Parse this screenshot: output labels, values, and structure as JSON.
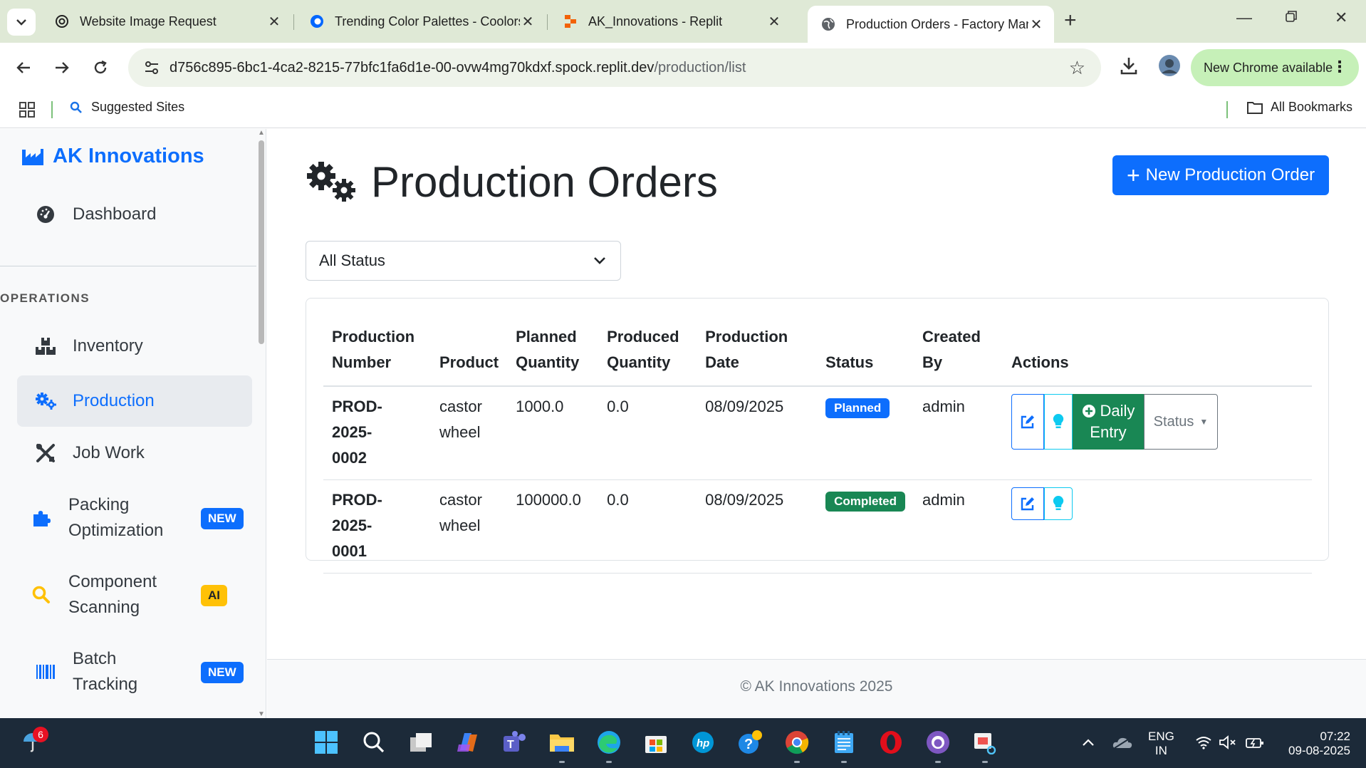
{
  "browser": {
    "tabs": [
      {
        "title": "Website Image Request",
        "icon": "openai-icon"
      },
      {
        "title": "Trending Color Palettes - Coolors",
        "icon": "coolors-icon"
      },
      {
        "title": "AK_Innovations - Replit",
        "icon": "replit-icon"
      },
      {
        "title": "Production Orders - Factory Management",
        "icon": "globe-icon"
      }
    ],
    "url_host": "d756c895-6bc1-4ca2-8215-77bfc1fa6d1e-00-ovw4mg70kdxf.spock.replit.dev",
    "url_path": "/production/list",
    "update_label": "New Chrome available",
    "bookmark_suggested": "Suggested Sites",
    "bookmark_all": "All Bookmarks"
  },
  "sidebar": {
    "brand": "AK Innovations",
    "dashboard": "Dashboard",
    "section_heading": "OPERATIONS",
    "items": [
      {
        "label": "Inventory"
      },
      {
        "label": "Production",
        "active": true
      },
      {
        "label": "Job Work"
      },
      {
        "label": "Packing Optimization",
        "line1": "Packing",
        "line2": "Optimization",
        "badge": "NEW"
      },
      {
        "label": "Component Scanning",
        "line1": "Component",
        "line2": "Scanning",
        "badge": "AI"
      },
      {
        "label": "Batch Tracking",
        "line1": "Batch",
        "line2": "Tracking",
        "badge": "NEW"
      }
    ]
  },
  "main": {
    "title": "Production Orders",
    "new_button": "New Production Order",
    "filter_value": "All Status",
    "table": {
      "headers": {
        "number_1": "Production",
        "number_2": "Number",
        "product": "Product",
        "planned_1": "Planned",
        "planned_2": "Quantity",
        "produced_1": "Produced",
        "produced_2": "Quantity",
        "date_1": "Production",
        "date_2": "Date",
        "status": "Status",
        "created_1": "Created",
        "created_2": "By",
        "actions": "Actions"
      },
      "rows": [
        {
          "number_1": "PROD-2025-",
          "number_2": "0002",
          "product_1": "castor",
          "product_2": "wheel",
          "planned": "1000.0",
          "produced": "0.0",
          "date": "08/09/2025",
          "status": "Planned",
          "created_by": "admin",
          "daily_1": "Daily",
          "daily_2": "Entry",
          "status_btn": "Status"
        },
        {
          "number_1": "PROD-2025-",
          "number_2": "0001",
          "product_1": "castor",
          "product_2": "wheel",
          "planned": "100000.0",
          "produced": "0.0",
          "date": "08/09/2025",
          "status": "Completed",
          "created_by": "admin"
        }
      ]
    },
    "footer": "© AK Innovations 2025"
  },
  "taskbar": {
    "notification_count": "6",
    "lang_1": "ENG",
    "lang_2": "IN",
    "time": "07:22",
    "date": "09-08-2025"
  },
  "colors": {
    "primary": "#0d6efd",
    "success": "#198754",
    "warning": "#ffc107",
    "info": "#0dcaf0",
    "taskbar": "#1c2a39"
  }
}
